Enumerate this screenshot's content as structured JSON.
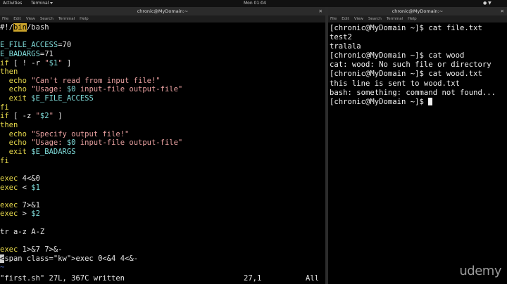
{
  "topbar": {
    "activities": "Activities",
    "app_name": "Terminal",
    "clock": "Mon 01:04"
  },
  "left_window": {
    "title": "chronic@MyDomain:~",
    "menu": [
      "File",
      "Edit",
      "View",
      "Search",
      "Terminal",
      "Help"
    ],
    "vim_lines": [
      "#!/bin/bash",
      "",
      "E_FILE_ACCESS=70",
      "E_BADARGS=71",
      "if [ ! -r \"$1\" ]",
      "then",
      "  echo \"Can't read from input file!\"",
      "  echo \"Usage: $0 input-file output-file\"",
      "  exit $E_FILE_ACCESS",
      "fi",
      "if [ -z \"$2\" ]",
      "then",
      "  echo \"Specify output file!\"",
      "  echo \"Usage: $0 input-file output-file\"",
      "  exit $E_BADARGS",
      "fi",
      "",
      "exec 4<&0",
      "exec < $1",
      "",
      "exec 7>&1",
      "exec > $2",
      "",
      "tr a-z A-Z",
      "",
      "exec 1>&7 7>&-",
      "exec 0<&4 4<&-",
      "~"
    ],
    "status_file": "\"first.sh\" 27L, 367C written",
    "status_pos": "27,1",
    "status_all": "All"
  },
  "right_window": {
    "title": "chronic@MyDomain:~",
    "menu": [
      "File",
      "Edit",
      "View",
      "Search",
      "Terminal",
      "Help"
    ],
    "lines": [
      "[chronic@MyDomain ~]$ cat file.txt",
      "test2",
      "tralala",
      "[chronic@MyDomain ~]$ cat wood",
      "cat: wood: No such file or directory",
      "[chronic@MyDomain ~]$ cat wood.txt",
      "this line is sent to wood.txt",
      "bash: something: command not found...",
      "[chronic@MyDomain ~]$ "
    ]
  },
  "watermark": "udemy"
}
